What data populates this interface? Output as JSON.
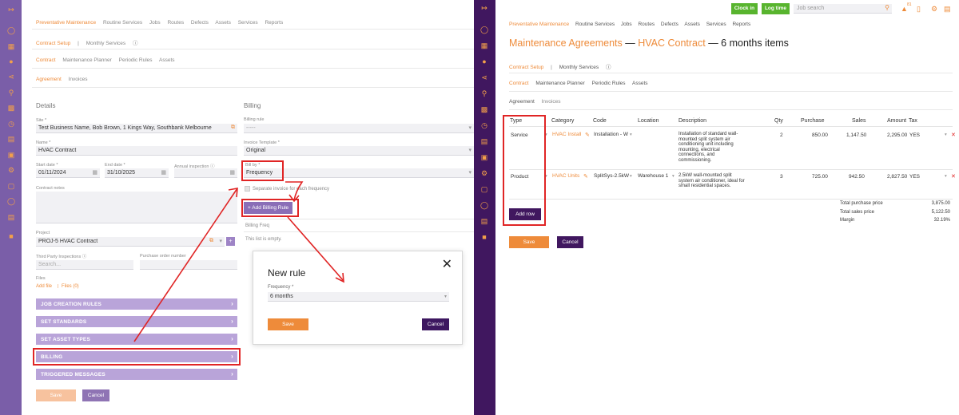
{
  "left": {
    "sidebar_icons": [
      "exit-icon",
      "tag-icon",
      "document-icon",
      "user-icon",
      "share-icon",
      "location-icon",
      "building-icon",
      "clock-icon",
      "invoice-icon",
      "box-icon",
      "gear-icon",
      "scan-icon",
      "shield-icon",
      "book-icon",
      "calendar-icon"
    ],
    "top_nav": [
      "Preventative Maintenance",
      "Routine Services",
      "Jobs",
      "Routes",
      "Defects",
      "Assets",
      "Services",
      "Reports"
    ],
    "sub_nav": [
      "Contract Setup",
      "|",
      "Monthly Services"
    ],
    "sub_nav2": [
      "Contract",
      "Maintenance Planner",
      "Periodic Rules",
      "Assets"
    ],
    "sub_nav3": [
      "Agreement",
      "Invoices"
    ],
    "details_title": "Details",
    "billing_title": "Billing",
    "site_label": "Site *",
    "site_value": "Test Business Name, Bob Brown, 1 Kings Way, Southbank Melbourne",
    "name_label": "Name *",
    "name_value": "HVAC Contract",
    "start_label": "Start date *",
    "start_value": "01/11/2024",
    "end_label": "End date *",
    "end_value": "31/10/2025",
    "annual_label": "Annual inspection",
    "notes_label": "Contract notes",
    "project_label": "Project",
    "project_value": "PROJ-5 HVAC Contract",
    "third_party_label": "Third Party Inspections",
    "third_party_placeholder": "Search...",
    "po_label": "Purchase order number",
    "files_label": "Files",
    "add_file": "Add file",
    "files_count": "Files (0)",
    "billing_rule_label": "Billing rule",
    "billing_rule_value": "-----",
    "invoice_template_label": "Invoice Template *",
    "invoice_template_value": "Original",
    "bill_by_label": "Bill by *",
    "bill_by_value": "Frequency",
    "separate_invoice": "Separate invoice for each frequency",
    "add_billing_rule": "+ Add Billing Rule",
    "billing_freq": "Billing Freq",
    "empty_list": "This list is empty.",
    "accordions": [
      "JOB CREATION RULES",
      "SET STANDARDS",
      "SET ASSET TYPES",
      "BILLING",
      "TRIGGERED MESSAGES"
    ],
    "save": "Save",
    "cancel": "Cancel",
    "modal": {
      "title": "New rule",
      "frequency_label": "Frequency *",
      "frequency_value": "6 months",
      "save": "Save",
      "cancel": "Cancel"
    }
  },
  "right": {
    "clock_in": "Clock in",
    "log_time": "Log time",
    "job_search_placeholder": "Job search",
    "notification_count": "81",
    "top_nav": [
      "Preventative Maintenance",
      "Routine Services",
      "Jobs",
      "Routes",
      "Defects",
      "Assets",
      "Services",
      "Reports"
    ],
    "title_part1": "Maintenance Agreements",
    "title_sep1": " — ",
    "title_part2": "HVAC Contract",
    "title_part3": " — 6 months items",
    "sub_nav": [
      "Contract Setup",
      "|",
      "Monthly Services"
    ],
    "sub_nav2": [
      "Contract",
      "Maintenance Planner",
      "Periodic Rules",
      "Assets"
    ],
    "sub_nav3": [
      "Agreement",
      "Invoices"
    ],
    "columns": [
      "Type",
      "Category",
      "Code",
      "Location",
      "Description",
      "Qty",
      "Purchase",
      "Sales",
      "Amount",
      "Tax"
    ],
    "rows": [
      {
        "type": "Service",
        "category": "HVAC Install",
        "code": "Installation - W",
        "location": "",
        "description": "Installation of standard wall-mounted split system air conditioning unit including mounting, electrical connections, and commissioning.",
        "qty": "2",
        "purchase": "850.00",
        "sales": "1,147.50",
        "amount": "2,295.00",
        "tax": "YES"
      },
      {
        "type": "Product",
        "category": "HVAC Units",
        "code": "SplitSys-2.5kW",
        "location": "Warehouse 1",
        "description": "2.5kW wall-mounted split system air conditioner, ideal for small residential spaces.",
        "qty": "3",
        "purchase": "725.00",
        "sales": "942.50",
        "amount": "2,827.50",
        "tax": "YES"
      }
    ],
    "add_row": "Add row",
    "totals": [
      {
        "label": "Total purchase price",
        "value": "3,875.00"
      },
      {
        "label": "Total sales price",
        "value": "5,122.50"
      },
      {
        "label": "Margin",
        "value": "32.19%"
      }
    ],
    "save": "Save",
    "cancel": "Cancel"
  },
  "colors": {
    "accent_orange": "#ee8b3a",
    "purple_light": "#b9a4d9",
    "purple_dark": "#40175f",
    "green": "#58b42e",
    "highlight_red": "#e02525"
  }
}
